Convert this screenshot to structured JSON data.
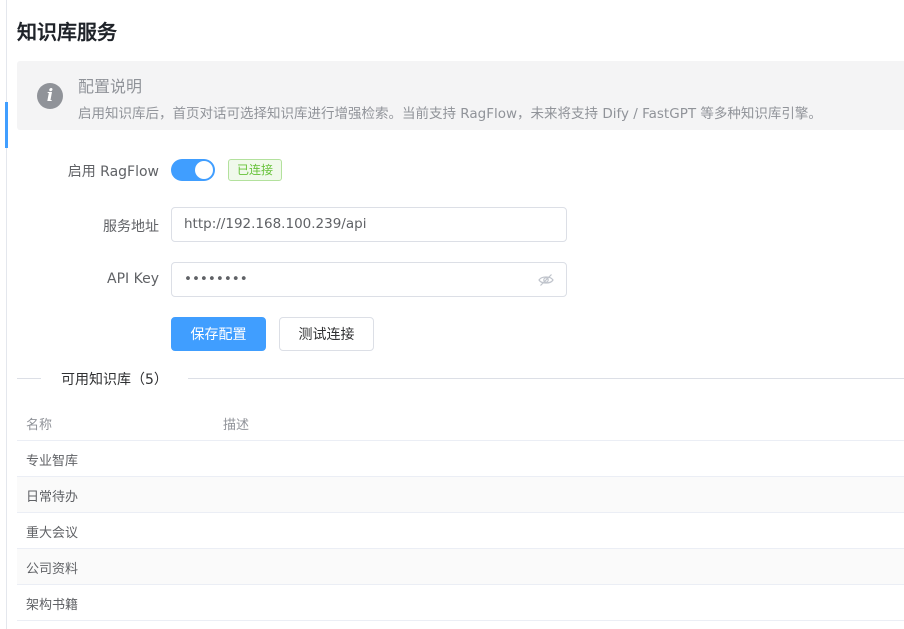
{
  "page": {
    "title": "知识库服务"
  },
  "info": {
    "title": "配置说明",
    "description": "启用知识库后，首页对话可选择知识库进行增强检索。当前支持 RagFlow，未来将支持 Dify / FastGPT 等多种知识库引擎。",
    "icon": "info-icon"
  },
  "form": {
    "enable_label": "启用 RagFlow",
    "enabled": true,
    "status_tag": "已连接",
    "address_label": "服务地址",
    "address_value": "http://192.168.100.239/api",
    "apikey_label": "API Key",
    "apikey_value": "••••••••",
    "save_button": "保存配置",
    "test_button": "测试连接"
  },
  "kb_section": {
    "title": "可用知识库（5）",
    "columns": [
      "名称",
      "描述"
    ],
    "rows": [
      {
        "name": "专业智库",
        "desc": ""
      },
      {
        "name": "日常待办",
        "desc": ""
      },
      {
        "name": "重大会议",
        "desc": ""
      },
      {
        "name": "公司资料",
        "desc": ""
      },
      {
        "name": "架构书籍",
        "desc": ""
      }
    ]
  },
  "colors": {
    "accent": "#409eff",
    "success": "#67c23a"
  }
}
